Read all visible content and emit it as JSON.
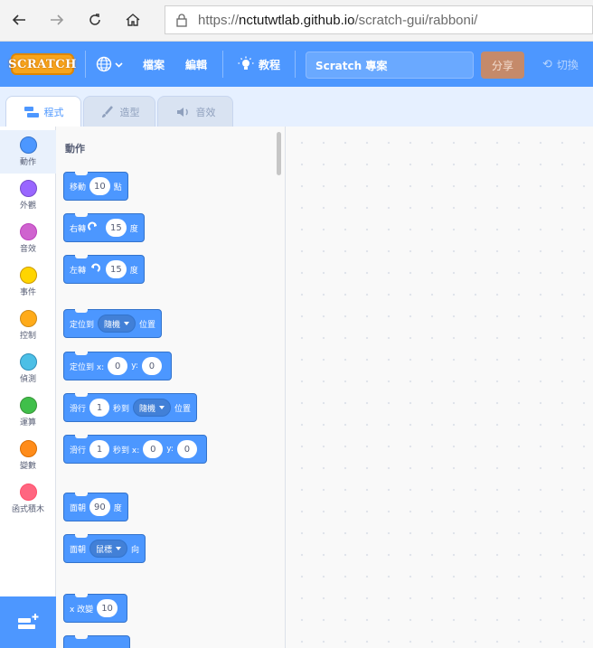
{
  "browser": {
    "url_prefix": "https://",
    "url_host": "nctutwtlab.github.io",
    "url_path": "/scratch-gui/rabboni/",
    "icons": [
      "back-icon",
      "forward-icon",
      "refresh-icon",
      "home-icon",
      "lock-icon"
    ]
  },
  "menubar": {
    "logo": "SCRATCH",
    "file": "檔案",
    "edit": "編輯",
    "tutorials": "教程",
    "project_title": "Scratch 專案",
    "share": "分享",
    "switch": "切換",
    "colors": {
      "bar": "#4d97ff",
      "logo": "#f8a51c"
    }
  },
  "tabs": [
    {
      "label": "程式",
      "active": true
    },
    {
      "label": "造型",
      "active": false
    },
    {
      "label": "音效",
      "active": false
    }
  ],
  "categories": [
    {
      "label": "動作",
      "color": "#4c97ff"
    },
    {
      "label": "外觀",
      "color": "#9966ff"
    },
    {
      "label": "音效",
      "color": "#cf63cf"
    },
    {
      "label": "事件",
      "color": "#ffd500"
    },
    {
      "label": "控制",
      "color": "#ffab19"
    },
    {
      "label": "偵測",
      "color": "#4cbfe6"
    },
    {
      "label": "運算",
      "color": "#40bf4a"
    },
    {
      "label": "變數",
      "color": "#ff8c1a"
    },
    {
      "label": "函式積木",
      "color": "#ff6680"
    }
  ],
  "palette": {
    "title": "動作",
    "blocks": {
      "move": {
        "pre": "移動",
        "value": "10",
        "post": "點"
      },
      "turn_right": {
        "pre": "右轉",
        "value": "15",
        "post": "度"
      },
      "turn_left": {
        "pre": "左轉",
        "value": "15",
        "post": "度"
      },
      "goto": {
        "pre": "定位到",
        "dropdown": "隨機",
        "post": "位置"
      },
      "goto_xy": {
        "pre": "定位到 x:",
        "x": "0",
        "mid": "y:",
        "y": "0"
      },
      "glide": {
        "pre": "滑行",
        "value": "1",
        "mid": "秒到",
        "dropdown": "隨機",
        "post": "位置"
      },
      "glide_xy": {
        "pre": "滑行",
        "value": "1",
        "mid": "秒到 x:",
        "x": "0",
        "ylabel": "y:",
        "y": "0"
      },
      "point_dir": {
        "pre": "面朝",
        "value": "90",
        "post": "度"
      },
      "point_toward": {
        "pre": "面朝",
        "dropdown": "鼠標",
        "post": "向"
      },
      "change_x": {
        "pre": "x 改變",
        "value": "10"
      }
    }
  }
}
